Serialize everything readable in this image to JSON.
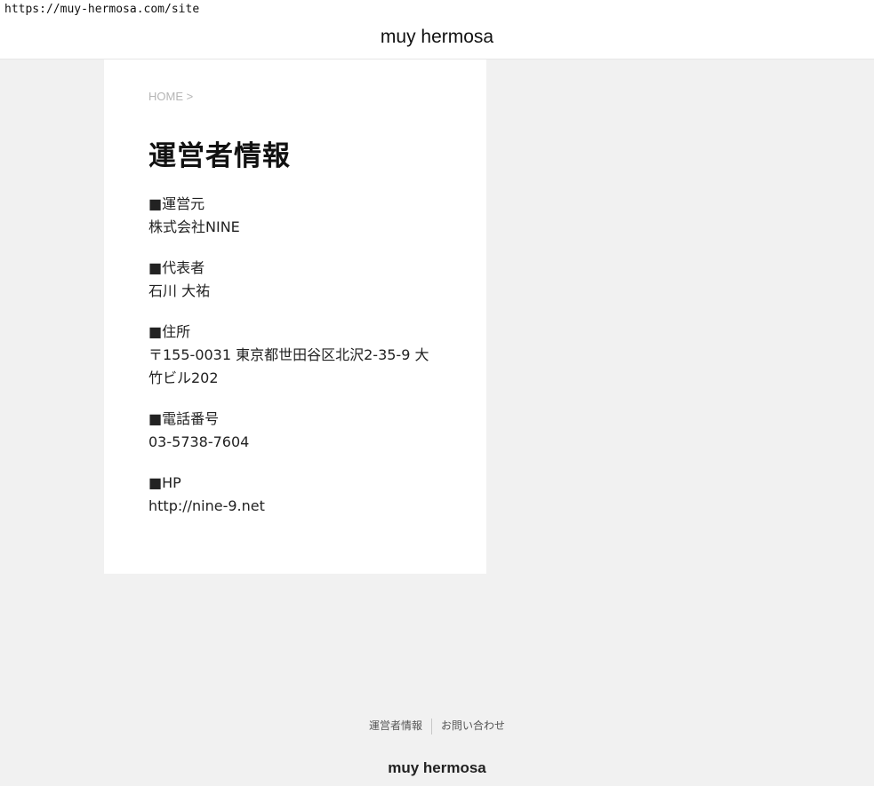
{
  "browser": {
    "url": "https://muy-hermosa.com/site"
  },
  "header": {
    "site_title": "muy hermosa"
  },
  "breadcrumb": {
    "home": "HOME",
    "separator": ">"
  },
  "page": {
    "title": "運営者情報",
    "items": [
      {
        "label": "■運営元",
        "value": "株式会社NINE"
      },
      {
        "label": "■代表者",
        "value": "石川 大祐"
      },
      {
        "label": "■住所",
        "value": "〒155-0031 東京都世田谷区北沢2-35-9 大竹ビル202"
      },
      {
        "label": "■電話番号",
        "value": "03-5738-7604"
      },
      {
        "label": "■HP",
        "value": "http://nine-9.net"
      }
    ]
  },
  "footer": {
    "nav": [
      {
        "label": "運営者情報"
      },
      {
        "label": "お問い合わせ"
      }
    ],
    "brand": "muy hermosa"
  }
}
